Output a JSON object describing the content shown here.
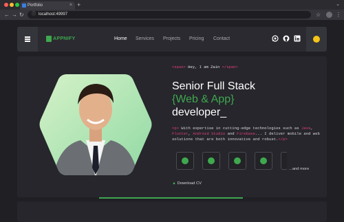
{
  "browser": {
    "tab_title": "Portfolio",
    "url": "localhost:49997",
    "close_glyph": "×",
    "new_tab_glyph": "+",
    "back_glyph": "←",
    "forward_glyph": "→",
    "reload_glyph": "↻",
    "star_glyph": "☆",
    "menu_glyph": "⋮",
    "chevron_glyph": "⌄",
    "lock_glyph": "ⓘ"
  },
  "header": {
    "brand": "APPNIFY",
    "nav": [
      "Home",
      "Services",
      "Projects",
      "Pricing",
      "Contact"
    ],
    "active": "Home"
  },
  "hero": {
    "tag_open": "<span>",
    "greeting": " Hey, I am Zain ",
    "tag_close": "</span>",
    "line1": "Senior Full Stack",
    "line2": "{Web & App}",
    "line3": "developer_",
    "p_open": "<p>",
    "p_text1": " With expertise in cutting-edge technologies such as ",
    "tech": [
      "Java",
      "Flutter",
      "Android Studio",
      "Firebase"
    ],
    "p_sep": ", ",
    "p_and": " and ",
    "p_text2": "... I deliver mobile and web solutions that are both innovative and robust.",
    "p_close": "</p>",
    "more": "...and more",
    "download": "Download CV"
  },
  "colors": {
    "accent": "#3fa84f",
    "tag": "#e0407a",
    "bg": "#1f1f24",
    "card": "#26262c",
    "sun": "#f5c518"
  },
  "icons": [
    "whatsapp-icon",
    "github-icon",
    "linkedin-icon",
    "theme-sun-icon",
    "hamburger-icon"
  ]
}
